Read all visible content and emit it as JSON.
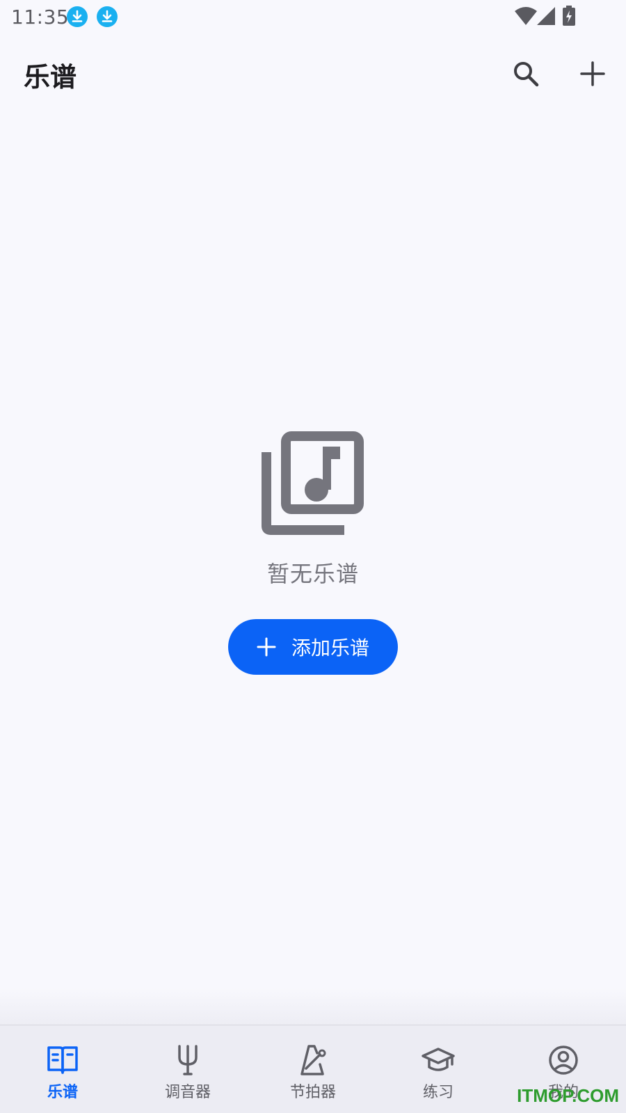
{
  "status_bar": {
    "time": "11:35",
    "icons": [
      "download-icon",
      "download-icon",
      "wifi-icon",
      "signal-icon",
      "battery-charging-icon"
    ]
  },
  "app_bar": {
    "title": "乐谱",
    "actions": [
      "search-icon",
      "add-icon"
    ]
  },
  "empty_state": {
    "icon": "music-library-icon",
    "message": "暂无乐谱",
    "button_label": "添加乐谱"
  },
  "bottom_nav": {
    "items": [
      {
        "label": "乐谱",
        "icon": "book-icon",
        "active": true
      },
      {
        "label": "调音器",
        "icon": "tuning-fork-icon",
        "active": false
      },
      {
        "label": "节拍器",
        "icon": "metronome-icon",
        "active": false
      },
      {
        "label": "练习",
        "icon": "graduation-cap-icon",
        "active": false
      },
      {
        "label": "我的",
        "icon": "account-circle-icon",
        "active": false
      }
    ]
  },
  "watermark": "ITMOP.COM",
  "colors": {
    "accent": "#0b63f6",
    "background": "#f8f8fd",
    "icon_gray": "#75757d",
    "download_badge": "#1ab0f0"
  }
}
